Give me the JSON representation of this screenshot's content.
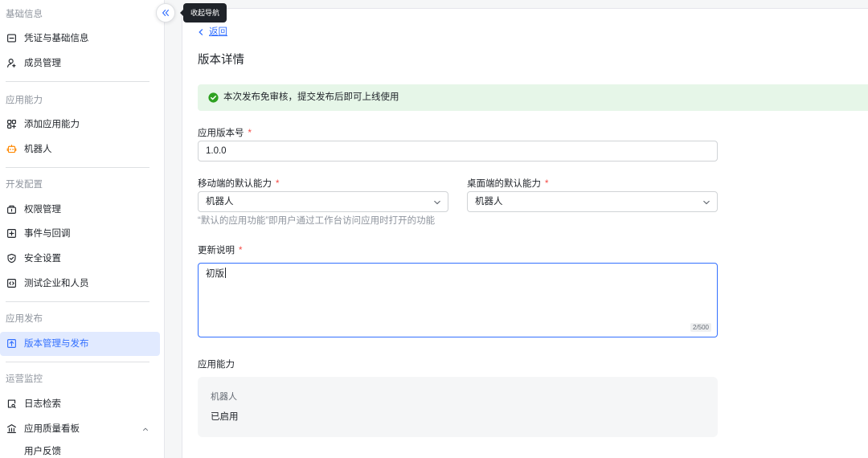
{
  "sidebar": {
    "collapse_tooltip": "收起导航",
    "sections": [
      {
        "title": "基础信息",
        "items": [
          {
            "label": "凭证与基础信息",
            "icon": "credential-icon"
          },
          {
            "label": "成员管理",
            "icon": "member-add-icon"
          }
        ]
      },
      {
        "title": "应用能力",
        "items": [
          {
            "label": "添加应用能力",
            "icon": "add-capability-icon"
          },
          {
            "label": "机器人",
            "icon": "robot-icon"
          }
        ]
      },
      {
        "title": "开发配置",
        "items": [
          {
            "label": "权限管理",
            "icon": "permission-icon"
          },
          {
            "label": "事件与回调",
            "icon": "event-plus-icon"
          },
          {
            "label": "安全设置",
            "icon": "shield-check-icon"
          },
          {
            "label": "测试企业和人员",
            "icon": "code-box-icon"
          }
        ]
      },
      {
        "title": "应用发布",
        "items": [
          {
            "label": "版本管理与发布",
            "icon": "upload-box-icon",
            "selected": true
          }
        ]
      },
      {
        "title": "运营监控",
        "items": [
          {
            "label": "日志检索",
            "icon": "log-search-icon"
          },
          {
            "label": "应用质量看板",
            "icon": "dashboard-columns-icon",
            "expanded": true
          },
          {
            "label": "用户反馈"
          }
        ]
      }
    ]
  },
  "main": {
    "back_label": "返回",
    "page_title": "版本详情",
    "alert": {
      "type": "success",
      "icon": "check-circle-icon",
      "text": "本次发布免审核，提交发布后即可上线使用"
    },
    "form": {
      "version": {
        "label": "应用版本号",
        "required_mark": "*",
        "value": "1.0.0"
      },
      "mobile_default": {
        "label": "移动端的默认能力",
        "required_mark": "*",
        "value": "机器人"
      },
      "desktop_default": {
        "label": "桌面端的默认能力",
        "required_mark": "*",
        "value": "机器人"
      },
      "default_help": "“默认的应用功能”即用户通过工作台访问应用时打开的功能",
      "notes": {
        "label": "更新说明",
        "required_mark": "*",
        "value": "初版",
        "counter": "2/500"
      }
    },
    "capabilities": {
      "title": "应用能力",
      "items": [
        {
          "name": "机器人",
          "status": "已启用"
        }
      ]
    }
  },
  "colors": {
    "primary": "#3370ff",
    "selected_bg": "#e1eaff",
    "success": "#2ea121",
    "success_bg": "#e6f6e8",
    "required": "#f54a45",
    "robot_icon": "#ff8800",
    "muted_text": "#8f959e"
  }
}
